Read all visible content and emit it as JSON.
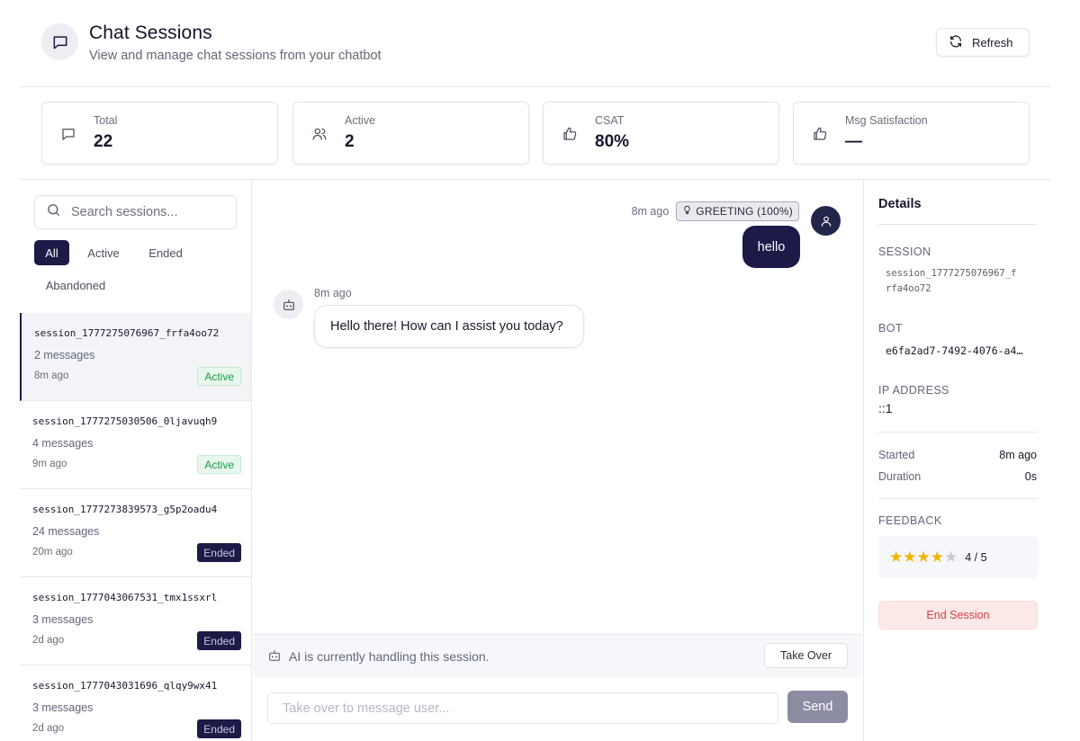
{
  "header": {
    "title": "Chat Sessions",
    "subtitle": "View and manage chat sessions from your chatbot",
    "refresh_label": "Refresh"
  },
  "stats": [
    {
      "label": "Total",
      "value": "22",
      "icon": "message-square-icon"
    },
    {
      "label": "Active",
      "value": "2",
      "icon": "users-icon"
    },
    {
      "label": "CSAT",
      "value": "80%",
      "icon": "thumbs-up-icon"
    },
    {
      "label": "Msg Satisfaction",
      "value": "—",
      "icon": "thumbs-up-icon"
    }
  ],
  "sidebar": {
    "search_placeholder": "Search sessions...",
    "filters": [
      "All",
      "Active",
      "Ended",
      "Abandoned"
    ],
    "selected_filter": "All",
    "sessions": [
      {
        "id": "session_1777275076967_frfa4oo72",
        "messages": "2 messages",
        "time": "8m ago",
        "status": "Active"
      },
      {
        "id": "session_1777275030506_0ljavuqh9",
        "messages": "4 messages",
        "time": "9m ago",
        "status": "Active"
      },
      {
        "id": "session_1777273839573_g5p2oadu4",
        "messages": "24 messages",
        "time": "20m ago",
        "status": "Ended"
      },
      {
        "id": "session_1777043067531_tmx1ssxrl",
        "messages": "3 messages",
        "time": "2d ago",
        "status": "Ended"
      },
      {
        "id": "session_1777043031696_qlqy9wx41",
        "messages": "3 messages",
        "time": "2d ago",
        "status": "Ended"
      }
    ]
  },
  "chat": {
    "user_msg": {
      "time": "8m ago",
      "intent": "GREETING (100%)",
      "text": "hello"
    },
    "bot_msg": {
      "time": "8m ago",
      "text": "Hello there! How can I assist you today?"
    },
    "ai_status": "AI is currently handling this session.",
    "takeover_label": "Take Over",
    "compose_placeholder": "Take over to message user...",
    "send_label": "Send"
  },
  "details": {
    "title": "Details",
    "session_label": "SESSION",
    "session_value": "session_1777275076967_frfa4oo72",
    "bot_label": "BOT",
    "bot_value": "e6fa2ad7-7492-4076-a4…",
    "ip_label": "IP ADDRESS",
    "ip_value": "::1",
    "started_label": "Started",
    "started_value": "8m ago",
    "duration_label": "Duration",
    "duration_value": "0s",
    "feedback_label": "FEEDBACK",
    "rating": 4,
    "rating_max": 5,
    "rating_text": "4 / 5",
    "end_label": "End Session"
  },
  "colors": {
    "accent": "#1c1a47",
    "active_badge": "#1d9a4a",
    "danger": "#d14343",
    "star": "#f2b300"
  }
}
